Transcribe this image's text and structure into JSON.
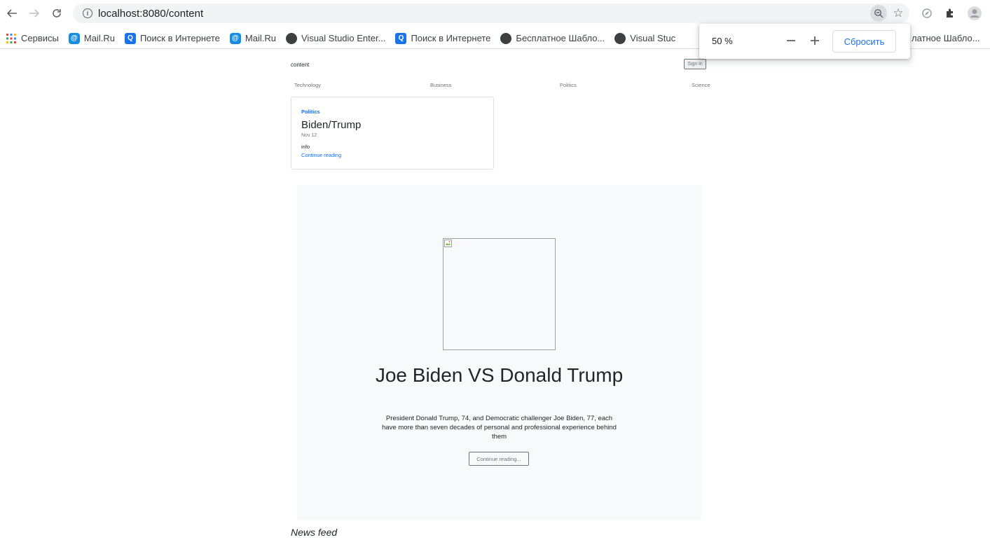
{
  "browser": {
    "url": "localhost:8080/content",
    "zoom_popup": {
      "level": "50 %",
      "minus": "—",
      "plus": "+",
      "reset_label": "Сбросить"
    }
  },
  "bookmarks": [
    {
      "label": "Сервисы",
      "icon": "apps-grid-icon"
    },
    {
      "label": "Mail.Ru",
      "icon": "mail-ru-icon"
    },
    {
      "label": "Поиск в Интернете",
      "icon": "search-icon"
    },
    {
      "label": "Mail.Ru",
      "icon": "mail-ru-icon"
    },
    {
      "label": "Visual Studio Enter...",
      "icon": "globe-icon"
    },
    {
      "label": "Поиск в Интернете",
      "icon": "search-icon"
    },
    {
      "label": "Бесплатное Шабло...",
      "icon": "globe-icon"
    },
    {
      "label": "Visual Stuc",
      "icon": "globe-icon"
    },
    {
      "label": "латное Шабло...",
      "icon": "none"
    }
  ],
  "site": {
    "title": "content",
    "signin_label": "Sign in",
    "nav": [
      "Technology",
      "Business",
      "Politics",
      "Science"
    ]
  },
  "card": {
    "category": "Politics",
    "title": "Biden/Trump",
    "date": "Nov 12",
    "info": "info",
    "link": "Continue reading"
  },
  "hero": {
    "title": "Joe Biden VS Donald Trump",
    "text": "President Donald Trump, 74, and Democratic challenger Joe Biden, 77, each have more than seven decades of personal and professional experience behind them",
    "button": "Continue reading..."
  },
  "newsfeed": "News feed",
  "colors": {
    "link_blue": "#0d6efd",
    "muted": "#6c757d",
    "hero_bg": "#f8f9fa",
    "chrome_accent": "#1a73e8"
  }
}
